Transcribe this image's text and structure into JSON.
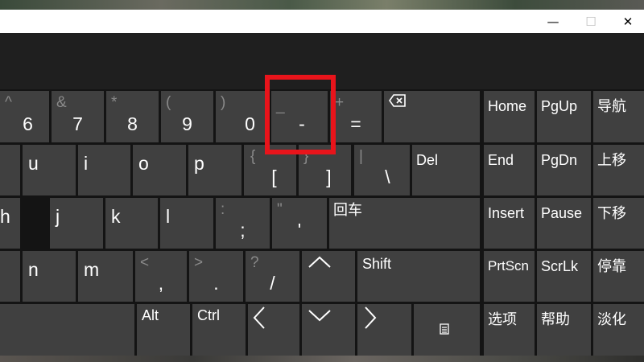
{
  "window": {
    "minimize_glyph": "—",
    "maximize_glyph": "☐",
    "close_glyph": "✕"
  },
  "colors": {
    "key": "#404040",
    "background": "#141414",
    "highlight": "#e8141b"
  },
  "keyboard": {
    "row1": {
      "k6": {
        "shift": "^",
        "main": "6"
      },
      "k7": {
        "shift": "&",
        "main": "7"
      },
      "k8": {
        "shift": "*",
        "main": "8"
      },
      "k9": {
        "shift": "(",
        "main": "9"
      },
      "k0": {
        "shift": ")",
        "main": "0"
      },
      "minus": {
        "shift": "_",
        "main": "-"
      },
      "equals": {
        "shift": "+",
        "main": "="
      },
      "backspace": {
        "icon": "backspace-icon"
      }
    },
    "row2": {
      "u": "u",
      "i": "i",
      "o": "o",
      "p": "p",
      "lbracket": {
        "shift": "{",
        "main": "["
      },
      "rbracket": {
        "shift": "}",
        "main": "]"
      },
      "backslash": {
        "shift": "|",
        "main": "\\"
      },
      "del": "Del"
    },
    "row3": {
      "h": "h",
      "j": "j",
      "k": "k",
      "l": "l",
      "semicolon": {
        "shift": ":",
        "main": ";"
      },
      "quote": {
        "shift": "\"",
        "main": "'"
      },
      "enter": "回车"
    },
    "row4": {
      "n": "n",
      "m": "m",
      "comma": {
        "shift": "<",
        "main": ","
      },
      "period": {
        "shift": ">",
        "main": "."
      },
      "slash": {
        "shift": "?",
        "main": "/"
      },
      "up": {
        "icon": "arrow-up-icon"
      },
      "shift": "Shift"
    },
    "row5": {
      "alt": "Alt",
      "ctrl": "Ctrl",
      "left": {
        "icon": "arrow-left-icon"
      },
      "down": {
        "icon": "arrow-down-icon"
      },
      "right": {
        "icon": "arrow-right-icon"
      },
      "menu": {
        "icon": "menu-icon"
      }
    },
    "nav": {
      "home": "Home",
      "pgup": "PgUp",
      "navigate": "导航",
      "end": "End",
      "pgdn": "PgDn",
      "moveup": "上移",
      "insert": "Insert",
      "pause": "Pause",
      "movedown": "下移",
      "prtscn": "PrtScn",
      "scrlk": "ScrLk",
      "dock": "停靠",
      "options": "选项",
      "help": "帮助",
      "fade": "淡化"
    }
  }
}
